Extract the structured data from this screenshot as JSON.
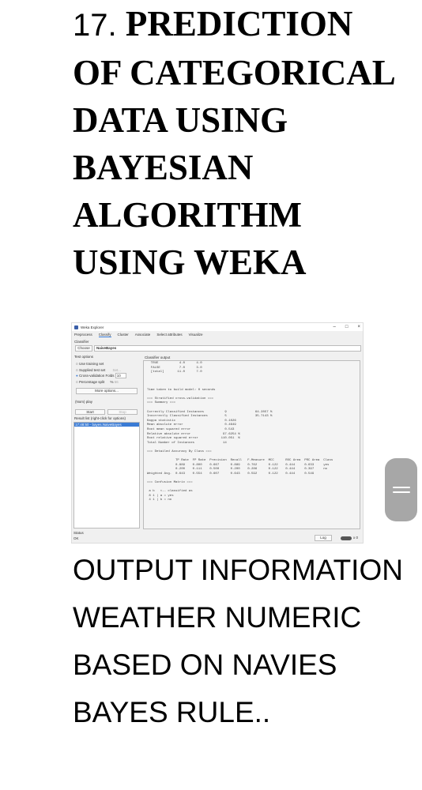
{
  "heading": {
    "number": "17.",
    "title": "PREDICTION OF CATEGORICAL DATA USING BAYESIAN ALGORITHM USING WEKA"
  },
  "weka": {
    "window_title": "Weka Explorer",
    "window_controls": [
      "–",
      "□",
      "×"
    ],
    "tabs": [
      "Preprocess",
      "Classify",
      "Cluster",
      "Associate",
      "Select attributes",
      "Visualize"
    ],
    "active_tab": "Classify",
    "classifier_label": "Classifier",
    "choose_label": "Choose",
    "classifier_value": "NaiveBayes",
    "test_options_label": "Test options",
    "options": [
      "Use training set",
      "Supplied test set",
      "Cross-validation",
      "Percentage split"
    ],
    "set_label": "Set...",
    "folds_label": "Folds",
    "folds_value": "10",
    "percent_label": "%",
    "percent_value": "66",
    "more_options": "More options...",
    "class_select": "(Nom) play",
    "start": "Start",
    "stop": "Stop",
    "result_list_label": "Result list (right-click for options)",
    "result_item": "17:48:50 - bayes.NaiveBayes",
    "output_label": "Classifier output",
    "output_text": "  TRUE           4.0      4.0\n  FALSE          7.0      3.0\n  [total]       11.0      7.0\n\n\n\nTime taken to build model: 0 seconds\n\n=== Stratified cross-validation ===\n=== Summary ===\n\nCorrectly Classified Instances           9               64.2857 %\nIncorrectly Classified Instances         5               35.7143 %\nKappa statistic                          0.1026\nMean absolute error                      0.4649\nRoot mean squared error                  0.543\nRelative absolute error                 97.6254 %\nRoot relative squared error            110.051  %\nTotal Number of Instances               14\n\n=== Detailed Accuracy By Class ===\n\n               TP Rate  FP Rate  Precision  Recall   F-Measure  MCC      ROC Area  PRC Area  Class\n               0.889    0.800    0.667      0.889    0.762      0.122    0.444     0.633     yes\n               0.200    0.111    0.500      0.200    0.286      0.122    0.444     0.397     no\nWeighted Avg.  0.643    0.554    0.607      0.643    0.592      0.122    0.444     0.549\n\n=== Confusion Matrix ===\n\n a b   <-- classified as\n 8 1 | a = yes\n 4 1 | b = no",
    "status_label": "Status",
    "status_value": "OK",
    "log_button": "Log",
    "x_count": "x 0"
  },
  "description": "OUTPUT INFORMATION WEATHER NUMERIC BASED ON NAVIES BAYES RULE.."
}
